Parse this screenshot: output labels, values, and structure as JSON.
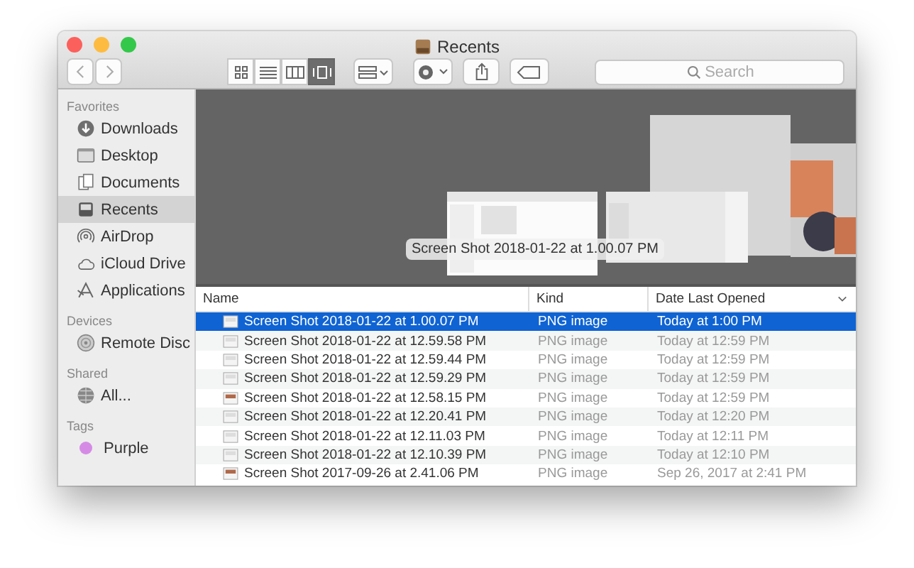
{
  "window": {
    "title": "Recents"
  },
  "toolbar": {
    "view_modes": [
      {
        "kind": "icons",
        "selected": false
      },
      {
        "kind": "list",
        "selected": false
      },
      {
        "kind": "columns",
        "selected": false
      },
      {
        "kind": "coverflow",
        "selected": true
      }
    ],
    "search": {
      "placeholder": "Search"
    }
  },
  "sidebar": {
    "sections": [
      {
        "title": "Favorites",
        "items": [
          {
            "label": "Downloads",
            "kind": "download",
            "selected": false
          },
          {
            "label": "Desktop",
            "kind": "desktop",
            "selected": false
          },
          {
            "label": "Documents",
            "kind": "documents",
            "selected": false
          },
          {
            "label": "Recents",
            "kind": "recents",
            "selected": true
          },
          {
            "label": "AirDrop",
            "kind": "airdrop",
            "selected": false
          },
          {
            "label": "iCloud Drive",
            "kind": "cloud",
            "selected": false
          },
          {
            "label": "Applications",
            "kind": "apps",
            "selected": false
          }
        ]
      },
      {
        "title": "Devices",
        "items": [
          {
            "label": "Remote Disc",
            "kind": "disc",
            "selected": false
          }
        ]
      },
      {
        "title": "Shared",
        "items": [
          {
            "label": "All...",
            "kind": "globe",
            "selected": false
          }
        ]
      },
      {
        "title": "Tags",
        "items": [
          {
            "label": "Purple",
            "kind": "tag",
            "color": "#d58be6",
            "selected": false
          }
        ]
      }
    ]
  },
  "coverflow": {
    "caption": "Screen Shot 2018-01-22 at 1.00.07 PM"
  },
  "table": {
    "columns": [
      "Name",
      "Kind",
      "Date Last Opened"
    ],
    "rows": [
      {
        "name": "Screen Shot 2018-01-22 at 1.00.07 PM",
        "kind": "PNG image",
        "date": "Today at 1:00 PM",
        "selected": true
      },
      {
        "name": "Screen Shot 2018-01-22 at 12.59.58 PM",
        "kind": "PNG image",
        "date": "Today at 12:59 PM",
        "selected": false
      },
      {
        "name": "Screen Shot 2018-01-22 at 12.59.44 PM",
        "kind": "PNG image",
        "date": "Today at 12:59 PM",
        "selected": false
      },
      {
        "name": "Screen Shot 2018-01-22 at 12.59.29 PM",
        "kind": "PNG image",
        "date": "Today at 12:59 PM",
        "selected": false
      },
      {
        "name": "Screen Shot 2018-01-22 at 12.58.15 PM",
        "kind": "PNG image",
        "date": "Today at 12:59 PM",
        "selected": false
      },
      {
        "name": "Screen Shot 2018-01-22 at 12.20.41 PM",
        "kind": "PNG image",
        "date": "Today at 12:20 PM",
        "selected": false
      },
      {
        "name": "Screen Shot 2018-01-22 at 12.11.03 PM",
        "kind": "PNG image",
        "date": "Today at 12:11 PM",
        "selected": false
      },
      {
        "name": "Screen Shot 2018-01-22 at 12.10.39 PM",
        "kind": "PNG image",
        "date": "Today at 12:10 PM",
        "selected": false
      },
      {
        "name": "Screen Shot 2017-09-26 at 2.41.06 PM",
        "kind": "PNG image",
        "date": "Sep 26, 2017 at 2:41 PM",
        "selected": false
      }
    ]
  }
}
